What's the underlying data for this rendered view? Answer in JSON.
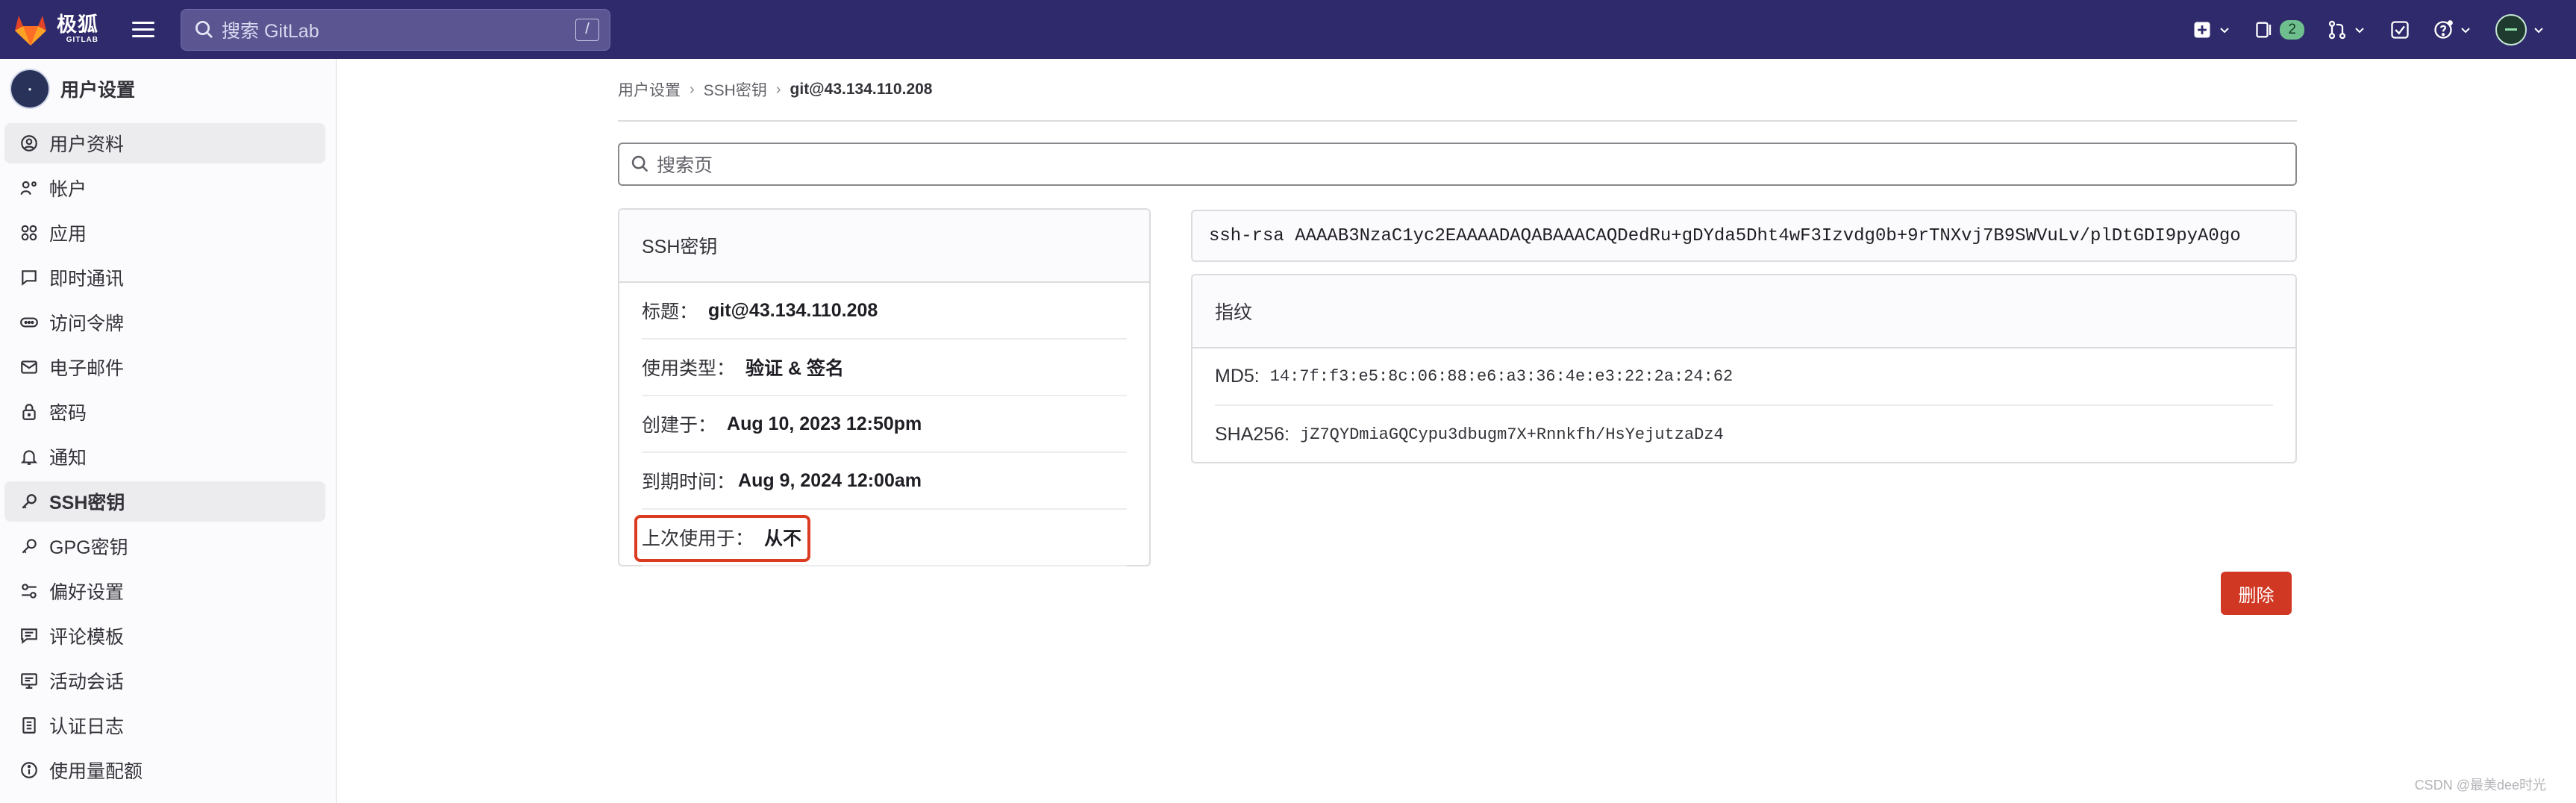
{
  "brand": {
    "name_cn": "极狐",
    "name_en": "GITLAB"
  },
  "topbar": {
    "search_placeholder": "搜索 GitLab",
    "search_shortcut": "/",
    "merge_requests_count": "2"
  },
  "sidebar": {
    "title": "用户设置",
    "items": [
      {
        "label": "用户资料",
        "icon": "user-circle-icon"
      },
      {
        "label": "帐户",
        "icon": "account-icon"
      },
      {
        "label": "应用",
        "icon": "applications-icon"
      },
      {
        "label": "即时通讯",
        "icon": "chat-icon"
      },
      {
        "label": "访问令牌",
        "icon": "token-icon"
      },
      {
        "label": "电子邮件",
        "icon": "mail-icon"
      },
      {
        "label": "密码",
        "icon": "lock-icon"
      },
      {
        "label": "通知",
        "icon": "bell-icon"
      },
      {
        "label": "SSH密钥",
        "icon": "key-icon"
      },
      {
        "label": "GPG密钥",
        "icon": "key-icon"
      },
      {
        "label": "偏好设置",
        "icon": "preferences-icon"
      },
      {
        "label": "评论模板",
        "icon": "comment-template-icon"
      },
      {
        "label": "活动会话",
        "icon": "monitor-icon"
      },
      {
        "label": "认证日志",
        "icon": "log-icon"
      },
      {
        "label": "使用量配额",
        "icon": "info-icon"
      }
    ]
  },
  "breadcrumb": {
    "items": [
      "用户设置",
      "SSH密钥"
    ],
    "current": "git@43.134.110.208"
  },
  "page_search_placeholder": "搜索页",
  "ssh_card": {
    "header": "SSH密钥",
    "rows": [
      {
        "label": "标题：",
        "value": "git@43.134.110.208"
      },
      {
        "label": "使用类型：",
        "value": "验证 & 签名"
      },
      {
        "label": "创建于：",
        "value": "Aug 10, 2023 12:50pm"
      },
      {
        "label": "到期时间：",
        "value": "Aug 9, 2024 12:00am"
      },
      {
        "label": "上次使用于：",
        "value": "从不"
      }
    ]
  },
  "public_key": "ssh-rsa AAAAB3NzaC1yc2EAAAADAQABAAACAQDedRu+gDYda5Dht4wF3Izvdg0b+9rTNXvj7B9SWVuLv/plDtGDI9pyA0go",
  "fingerprint_card": {
    "header": "指纹",
    "rows": [
      {
        "label": "MD5:",
        "value": "14:7f:f3:e5:8c:06:88:e6:a3:36:4e:e3:22:2a:24:62"
      },
      {
        "label": "SHA256:",
        "value": "jZ7QYDmiaGQCypu3dbugm7X+Rnnkfh/HsYejutzaDz4"
      }
    ]
  },
  "delete_button": "删除",
  "watermark": "CSDN @最美dee时光",
  "colors": {
    "topbar": "#2f2a6b",
    "danger": "#d03823",
    "highlight_border": "#db3b21"
  }
}
